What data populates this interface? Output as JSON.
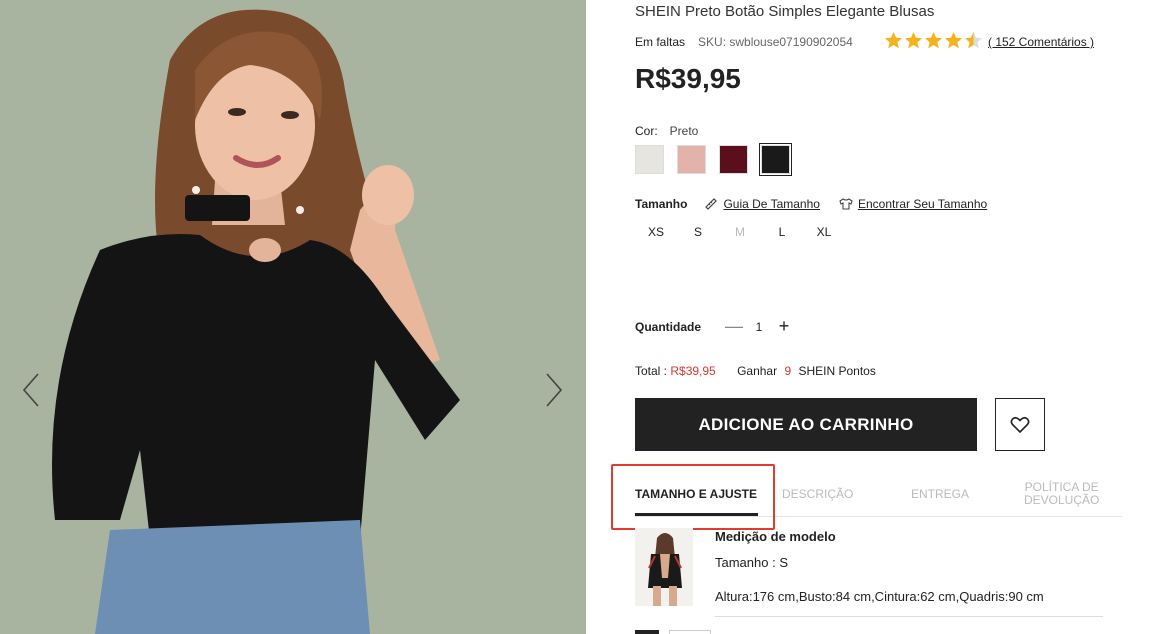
{
  "product": {
    "title": "SHEIN Preto Botão Simples Elegante Blusas",
    "stock": "Em faltas",
    "sku": "SKU: swblouse07190902054",
    "rating": 4.5,
    "reviews_label": "( 152 Comentários )",
    "price": "R$39,95"
  },
  "color": {
    "label": "Cor:",
    "selected": "Preto",
    "swatches": [
      "#e6e5e0",
      "#e3b3aa",
      "#5a0f1a",
      "#1a1a1a"
    ]
  },
  "size": {
    "label": "Tamanho",
    "guide_link": "Guia De Tamanho",
    "find_link": "Encontrar Seu Tamanho",
    "options": [
      "XS",
      "S",
      "M",
      "L",
      "XL"
    ]
  },
  "quantity": {
    "label": "Quantidade",
    "minus": "—",
    "value": "1",
    "plus": "+"
  },
  "total": {
    "label": "Total :",
    "amount": "R$39,95",
    "earn_label": "Ganhar",
    "points": "9",
    "points_label": "SHEIN Pontos"
  },
  "actions": {
    "add_to_cart": "ADICIONE AO CARRINHO"
  },
  "tabs": {
    "size_fit": "TAMANHO E AJUSTE",
    "description": "DESCRIÇÃO",
    "delivery": "ENTREGA",
    "return_line1": "POLÍTICA DE",
    "return_line2": "DEVOLUÇÃO"
  },
  "model": {
    "title": "Medição de modelo",
    "size": "Tamanho : S",
    "measures": "Altura:176 cm,Busto:84 cm,Cintura:62 cm,Quadris:90 cm"
  },
  "colors": {
    "star": "#f5b21b",
    "accent_red": "#d23a2e",
    "highlight": "#e23a2e",
    "button_bg": "#222222"
  }
}
